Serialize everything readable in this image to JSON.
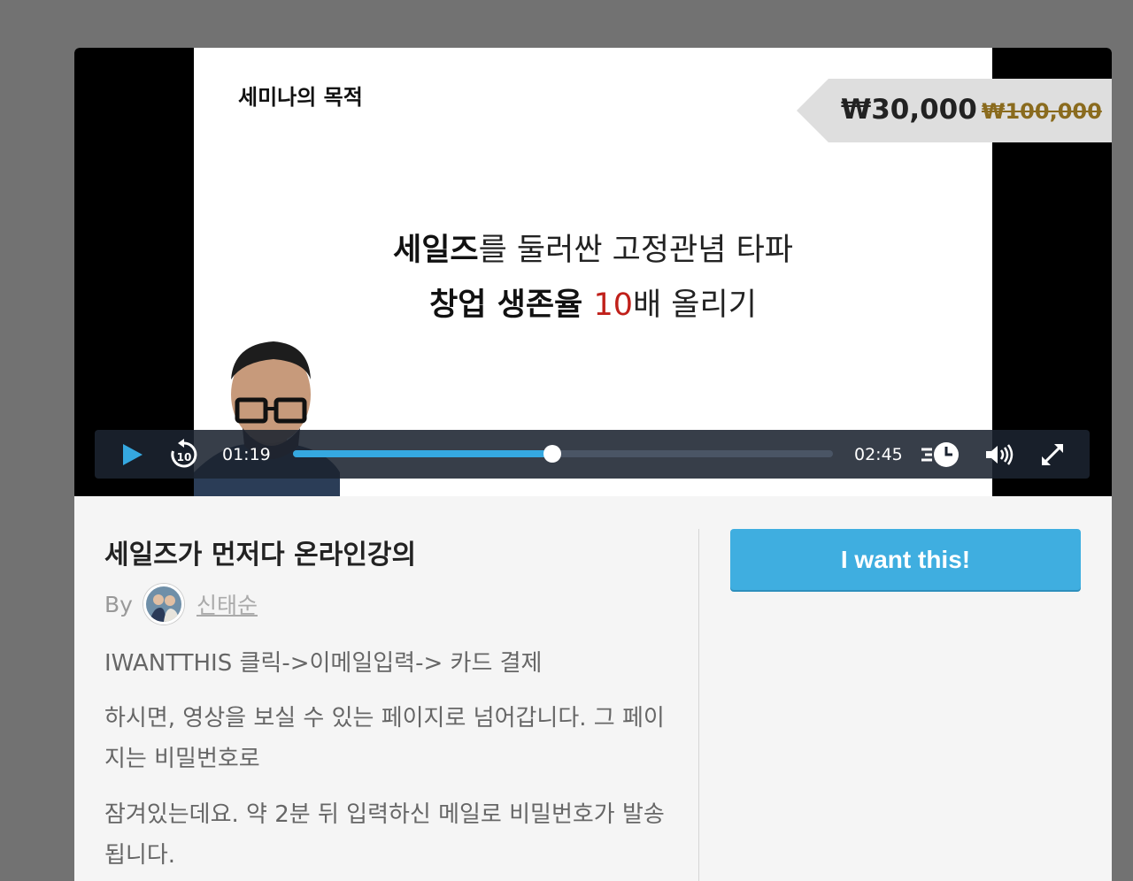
{
  "video": {
    "slide": {
      "heading": "세미나의 목적",
      "line1_bold": "세일즈",
      "line1_rest": "를 둘러싼 고정관념 타파",
      "line2_bold": "창업 생존율 ",
      "line2_red": "10",
      "line2_rest": "배 올리기"
    },
    "price": {
      "current": "₩30,000",
      "original": "₩100,000"
    },
    "player": {
      "current_time": "01:19",
      "duration": "02:45",
      "progress": 0.48,
      "rewind_seconds": "10",
      "accent_color": "#35a8e0"
    },
    "icons": [
      "play-icon",
      "rewind-10-icon",
      "playback-speed-icon",
      "volume-icon",
      "fullscreen-icon"
    ]
  },
  "product": {
    "title": "세일즈가 먼저다 온라인강의",
    "by_label": "By",
    "author": "신태순",
    "description": [
      "IWANTTHIS 클릭->이메일입력-> 카드 결제",
      "하시면, 영상을 보실 수 있는 페이지로 넘어갑니다. 그 페이지는 비밀번호로",
      "잠겨있는데요. 약 2분 뒤 입력하신 메일로 비밀번호가 발송됩니다."
    ]
  },
  "cta": {
    "label": "I want this!",
    "color": "#3faee0"
  }
}
